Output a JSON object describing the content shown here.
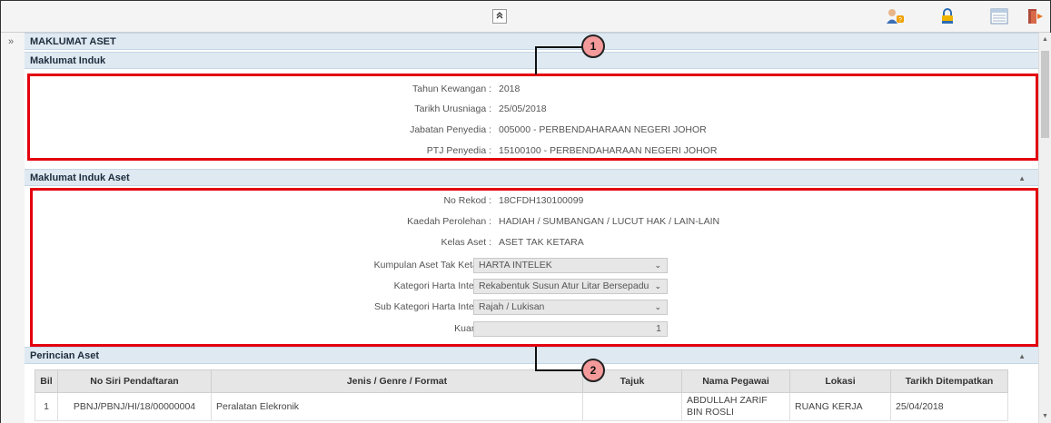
{
  "toolbar": {
    "collapse_glyph": "≈",
    "icons": [
      "user-help-icon",
      "lock-icon",
      "table-view-icon",
      "logout-icon"
    ]
  },
  "sidebar": {
    "expand_glyph": "»"
  },
  "panel": {
    "title": "MAKLUMAT ASET"
  },
  "sections": {
    "induk": {
      "title": "Maklumat Induk",
      "fields": [
        {
          "label": "Tahun Kewangan :",
          "value": "2018"
        },
        {
          "label": "Tarikh Urusniaga :",
          "value": "25/05/2018"
        },
        {
          "label": "Jabatan Penyedia :",
          "value": "005000 - PERBENDAHARAAN NEGERI JOHOR"
        },
        {
          "label": "PTJ Penyedia :",
          "value": "15100100 - PERBENDAHARAAN NEGERI JOHOR"
        }
      ]
    },
    "induk_aset": {
      "title": "Maklumat Induk Aset",
      "fields": [
        {
          "label": "No Rekod :",
          "value": "18CFDH130100099"
        },
        {
          "label": "Kaedah Perolehan :",
          "value": "HADIAH / SUMBANGAN / LUCUT HAK / LAIN-LAIN"
        },
        {
          "label": "Kelas Aset :",
          "value": "ASET TAK KETARA"
        }
      ],
      "selects": [
        {
          "label": "Kumpulan Aset Tak Ketara :",
          "value": "HARTA INTELEK"
        },
        {
          "label": "Kategori Harta Intelek :",
          "value": "Rekabentuk Susun Atur Litar Bersepadu"
        },
        {
          "label": "Sub Kategori Harta Intelek :",
          "value": "Rajah / Lukisan"
        }
      ],
      "quantity": {
        "label": "Kuantiti :",
        "value": "1"
      }
    },
    "perincian": {
      "title": "Perincian Aset",
      "columns": [
        "Bil",
        "No Siri Pendaftaran",
        "Jenis / Genre / Format",
        "Tajuk",
        "Nama Pegawai",
        "Lokasi",
        "Tarikh Ditempatkan"
      ],
      "rows": [
        [
          "1",
          "PBNJ/PBNJ/HI/18/00000004",
          "Peralatan Elekronik",
          "",
          "ABDULLAH ZARIF BIN ROSLI",
          "RUANG KERJA",
          "25/04/2018"
        ]
      ]
    }
  },
  "callouts": [
    "1",
    "2"
  ],
  "colors": {
    "highlight": "#e3000f",
    "header_bg": "#dfe9f2",
    "callout_fill": "#f59a9a"
  }
}
